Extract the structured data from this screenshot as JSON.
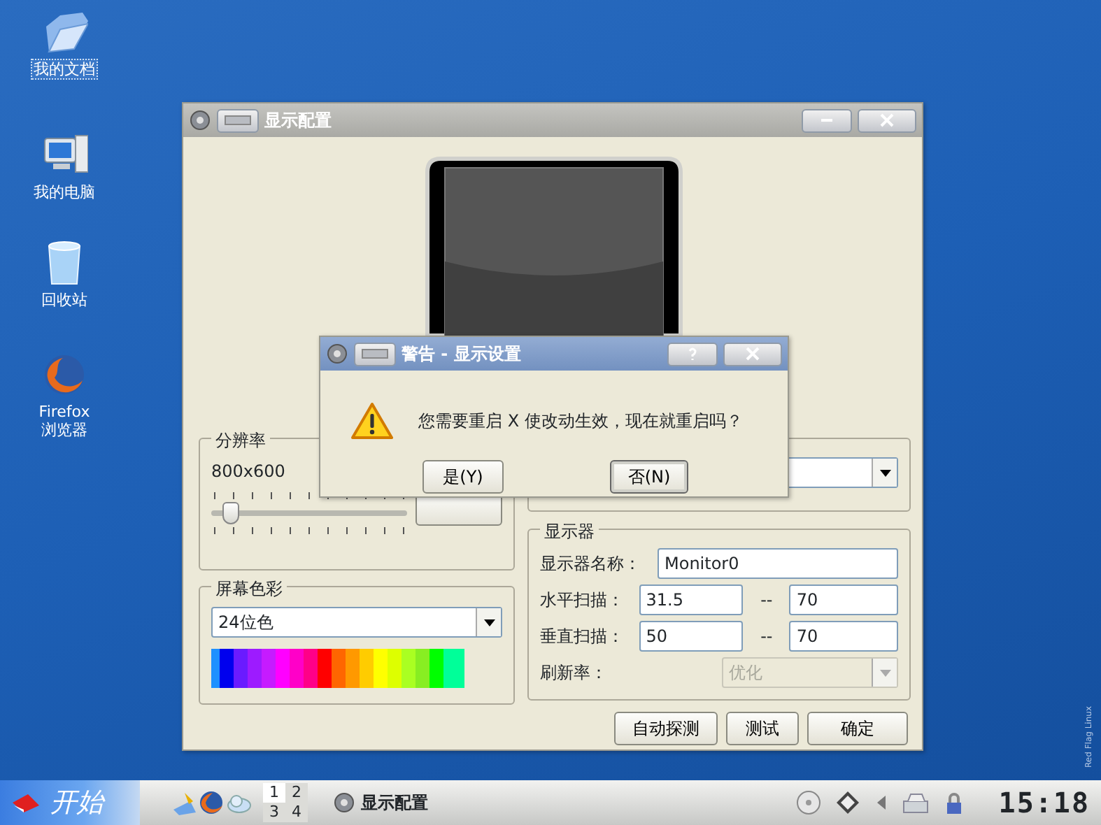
{
  "desktop_icons": [
    {
      "kind": "folder",
      "label": "我的文档",
      "selected": true
    },
    {
      "kind": "computer",
      "label": "我的电脑",
      "selected": false
    },
    {
      "kind": "trash",
      "label": "回收站",
      "selected": false
    },
    {
      "kind": "browser",
      "label": "Firefox\n浏览器",
      "selected": false
    }
  ],
  "main_window": {
    "title": "显示配置",
    "active": false,
    "resolution": {
      "title": "分辨率",
      "value": "800x600",
      "level": 0.1
    },
    "color_depth": {
      "title": "屏幕色彩",
      "value": "24位色"
    },
    "monitor": {
      "title": "显示器",
      "fields": [
        {
          "kind": "text",
          "label": "显示器名称：",
          "value": "Monitor0",
          "disabled": false
        },
        {
          "kind": "range",
          "label": "水平扫描：",
          "from": "31.5",
          "separator": "--",
          "to": "70",
          "disabled": false
        },
        {
          "kind": "range",
          "label": "垂直扫描：",
          "from": "50",
          "separator": "--",
          "to": "70",
          "disabled": false
        },
        {
          "kind": "combo",
          "label": "刷新率：",
          "value": "优化",
          "disabled": true
        }
      ]
    },
    "buttons": [
      "自动探测",
      "测试",
      "确定"
    ]
  },
  "dialog": {
    "title": "警告 - 显示设置",
    "active": true,
    "message": "您需要重启 X 使改动生效，现在就重启吗？",
    "buttons": [
      {
        "label": "是(Y)",
        "selected": false
      },
      {
        "label": "否(N)",
        "selected": true
      }
    ]
  },
  "taskbar": {
    "start": "开始",
    "desktops": [
      {
        "label": "1",
        "selected": true
      },
      {
        "label": "2",
        "selected": false
      },
      {
        "label": "3",
        "selected": false
      },
      {
        "label": "4",
        "selected": false
      }
    ],
    "tasks": [
      {
        "label": "显示配置"
      }
    ],
    "clock": "15:18"
  },
  "branding": "Red Flag Linux"
}
